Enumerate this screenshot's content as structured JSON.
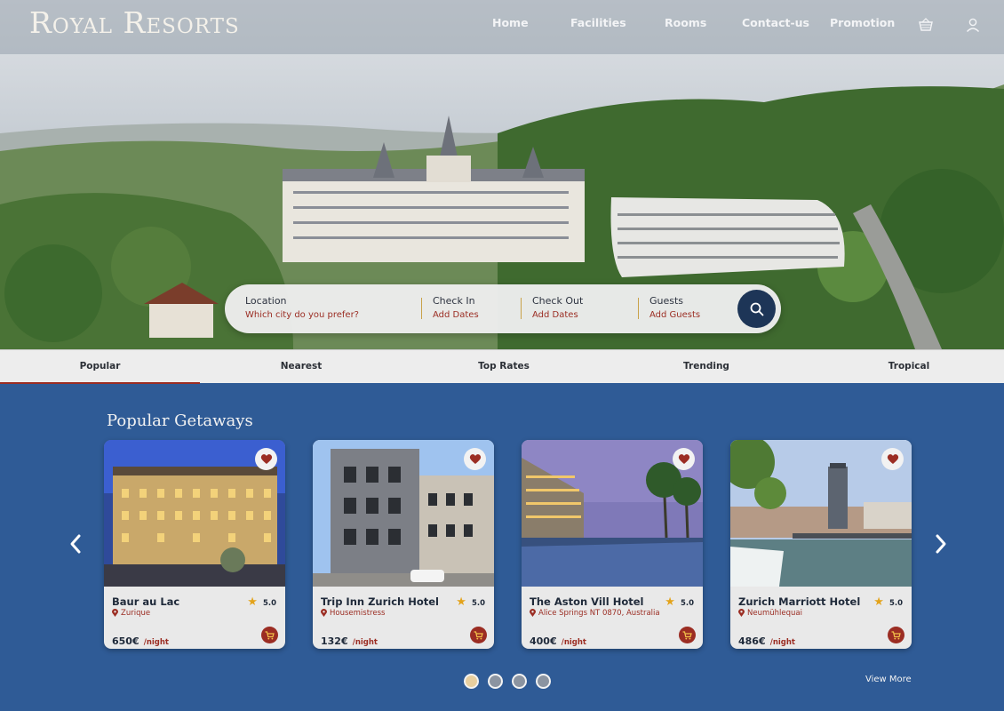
{
  "brand": {
    "logo": "Royal Resorts"
  },
  "nav": {
    "items": [
      "Home",
      "Facilities",
      "Rooms",
      "Contact-us",
      "Promotion"
    ],
    "cart_icon": "basket-icon",
    "user_icon": "user-icon"
  },
  "search": {
    "location": {
      "label": "Location",
      "placeholder": "Which city do you prefer?"
    },
    "check_in": {
      "label": "Check In",
      "placeholder": "Add Dates"
    },
    "check_out": {
      "label": "Check Out",
      "placeholder": "Add Dates"
    },
    "guests": {
      "label": "Guests",
      "placeholder": "Add Guests"
    },
    "button_icon": "search-icon"
  },
  "tabs": {
    "items": [
      "Popular",
      "Nearest",
      "Top Rates",
      "Trending",
      "Tropical"
    ],
    "active": "Popular"
  },
  "section": {
    "title": "Popular Getaways",
    "view_more": "View More"
  },
  "cards": [
    {
      "name": "Baur au Lac",
      "location": "Zurique",
      "rating": "5.0",
      "price": "650€",
      "unit": "/night"
    },
    {
      "name": "Trip Inn Zurich Hotel",
      "location": "Housemistress",
      "rating": "5.0",
      "price": "132€",
      "unit": "/night"
    },
    {
      "name": "The Aston Vill Hotel",
      "location": "Alice Springs NT 0870, Australia",
      "rating": "5.0",
      "price": "400€",
      "unit": "/night"
    },
    {
      "name": "Zurich Marriott Hotel",
      "location": "Neumühlequai",
      "rating": "5.0",
      "price": "486€",
      "unit": "/night"
    }
  ],
  "carousel": {
    "pages": 4,
    "active_page": 1
  },
  "colors": {
    "accent": "#9b2d23",
    "navy": "#1d3557",
    "section_bg": "#2f5b96",
    "star": "#e3a31b",
    "tab_bg": "#ededed"
  }
}
